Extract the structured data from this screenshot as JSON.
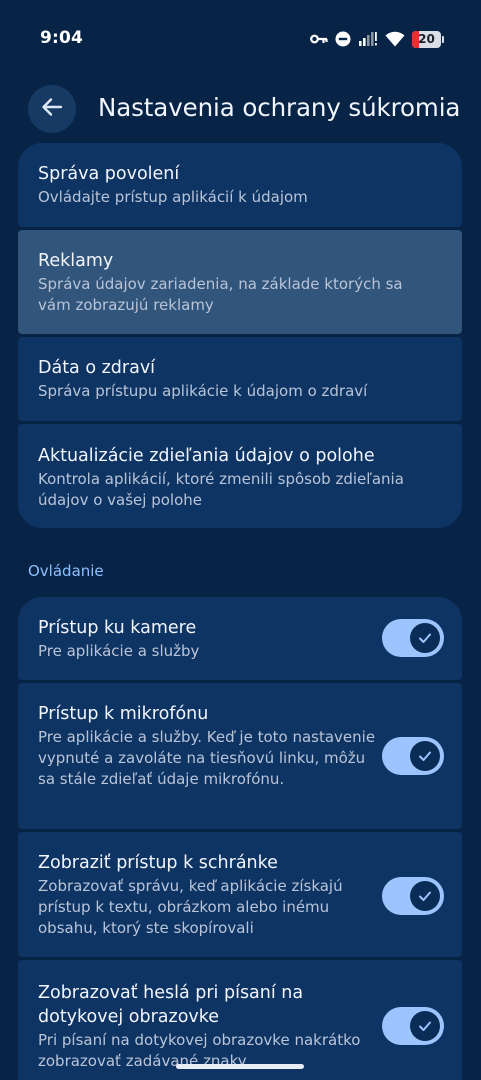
{
  "status_bar": {
    "time": "9:04",
    "battery_level": "20",
    "icons": [
      "vpn-key-icon",
      "do-not-disturb-icon",
      "cellular-signal-icon",
      "wifi-icon",
      "battery-icon"
    ]
  },
  "header": {
    "title": "Nastavenia ochrany súkromia",
    "back_icon": "arrow-back-icon"
  },
  "privacy_items": [
    {
      "title": "Správa povolení",
      "subtitle": "Ovládajte prístup aplikácií k údajom"
    },
    {
      "title": "Reklamy",
      "subtitle": "Správa údajov zariadenia, na základe ktorých sa vám zobrazujú reklamy"
    },
    {
      "title": "Dáta o zdraví",
      "subtitle": "Správa prístupu aplikácie k údajom o zdraví"
    },
    {
      "title": "Aktualizácie zdieľania údajov o polohe",
      "subtitle": "Kontrola aplikácií, ktoré zmenili spôsob zdieľania údajov o vašej polohe"
    }
  ],
  "controls_section": {
    "header": "Ovládanie",
    "items": [
      {
        "title": "Prístup ku kamere",
        "subtitle": "Pre aplikácie a služby",
        "enabled": true
      },
      {
        "title": "Prístup k mikrofónu",
        "subtitle": "Pre aplikácie a služby. Keď je toto nastavenie vypnuté a zavoláte na tiesňovú linku, môžu sa stále zdieľať údaje mikrofónu.",
        "enabled": true
      },
      {
        "title": "Zobraziť prístup k schránke",
        "subtitle": "Zobrazovať správu, keď aplikácie získajú prístup k textu, obrázkom alebo inému obsahu, ktorý ste skopírovali",
        "enabled": true
      },
      {
        "title": "Zobrazovať heslá pri písaní na",
        "title_line2": "dotykovej obrazovke",
        "subtitle": "Pri písaní na dotykovej obrazovke nakrátko zobrazovať zadávané znaky",
        "enabled": true
      }
    ]
  },
  "colors": {
    "background": "#072447",
    "card": "#0e3463",
    "card_highlight": "#31557b",
    "accent": "#9cc4ff",
    "section_header": "#8ec0ff"
  }
}
